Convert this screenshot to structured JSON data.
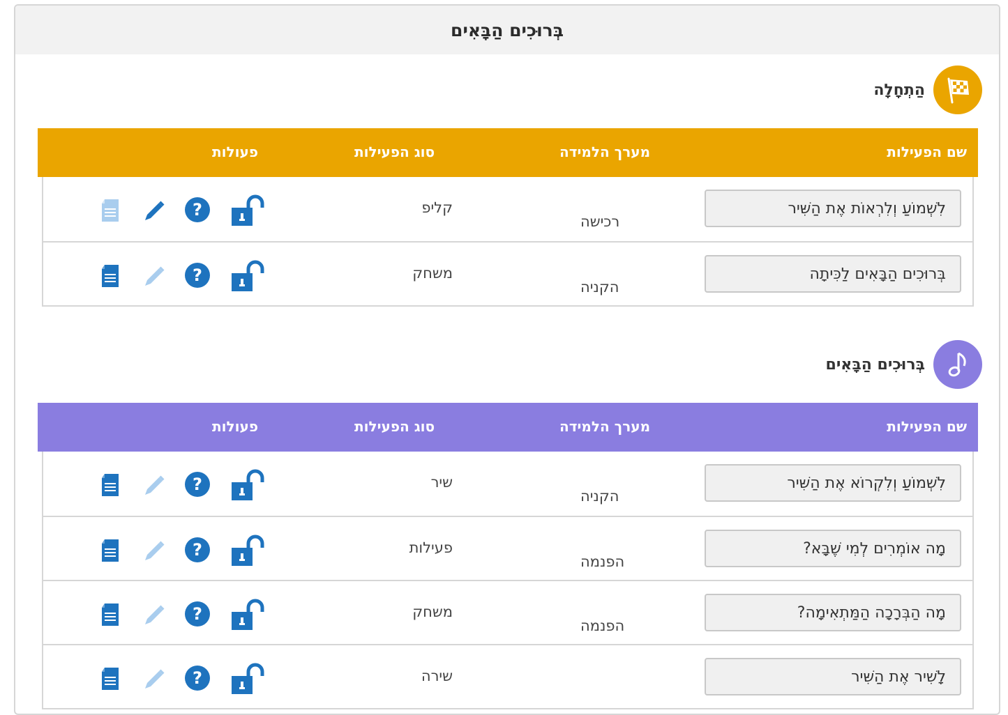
{
  "header": {
    "title": "בְּרוּכִים הַבָּאִים"
  },
  "columns": {
    "name": "שם הפעילות",
    "env": "מערך הלמידה",
    "type": "סוג הפעילות",
    "actions": "פעולות"
  },
  "sections": [
    {
      "title": "הַתְחָלָה",
      "icon": "checkered-flag-icon",
      "color": "#eaa500",
      "rows": [
        {
          "name": "לִשְׁמוֹעַ וְלִרְאוֹת אֶת הַשִּׁיר",
          "env": "רכישה",
          "type": "קליפ",
          "edit_enabled": true,
          "document_enabled": false
        },
        {
          "name": "בְּרוּכִים הַבָּאִים לַכִּיתָה",
          "env": "הקניה",
          "type": "משחק",
          "edit_enabled": false,
          "document_enabled": true
        }
      ]
    },
    {
      "title": "בְּרוּכִים הַבָּאִים",
      "icon": "music-note-icon",
      "color": "#8a7de0",
      "rows": [
        {
          "name": "לִשְׁמוֹעַ וְלִקְרוֹא אֶת הַשִּׁיר",
          "env": "הקניה",
          "type": "שיר",
          "edit_enabled": false,
          "document_enabled": true
        },
        {
          "name": "מָה אוֹמְרִים לְמִי שֶׁבָּא?",
          "env": "הפנמה",
          "type": "פעילות",
          "edit_enabled": false,
          "document_enabled": true
        },
        {
          "name": "מָה הַבְּרָכָה הַמַּתְאִימָה?",
          "env": "הפנמה",
          "type": "משחק",
          "edit_enabled": false,
          "document_enabled": true
        },
        {
          "name": "לָשִׁיר אֶת הַשִּׁיר",
          "env": "",
          "type": "שירה",
          "edit_enabled": false,
          "document_enabled": true
        }
      ]
    }
  ],
  "colors": {
    "icon_blue": "#1e73be",
    "icon_light": "#a9cdee"
  }
}
